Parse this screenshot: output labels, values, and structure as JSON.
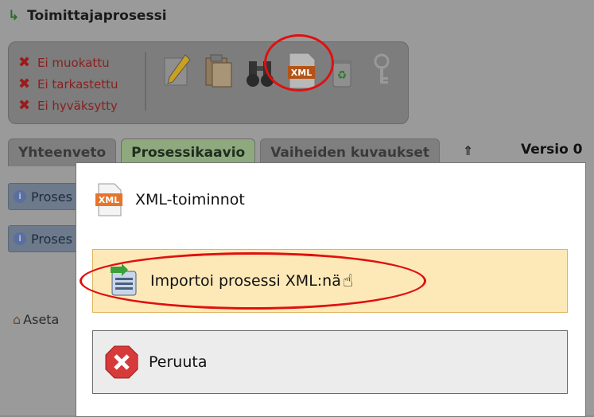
{
  "app": {
    "title": "Toimittajaprosessi"
  },
  "status": [
    "Ei muokattu",
    "Ei tarkastettu",
    "Ei hyväksytty"
  ],
  "toolbar": {
    "icons": [
      "pencil-icon",
      "clipboard-icon",
      "binoculars-icon",
      "xml-icon",
      "recycle-icon",
      "key-icon"
    ],
    "xml_label": "XML"
  },
  "tabs": [
    {
      "label": "Yhteenveto",
      "active": false
    },
    {
      "label": "Prosessikaavio",
      "active": true
    },
    {
      "label": "Vaiheiden kuvaukset",
      "active": false
    }
  ],
  "version": "Versio 0",
  "rows": [
    "Proses",
    "Proses"
  ],
  "aseta": "Aseta",
  "modal": {
    "title": "XML-toiminnot",
    "xml_badge": "XML",
    "import": "Importoi prosessi XML:nä",
    "cancel": "Peruuta"
  },
  "colors": {
    "highlight": "#e01010",
    "import_bg": "#fde9b8",
    "active_tab": "#8ea97e"
  }
}
